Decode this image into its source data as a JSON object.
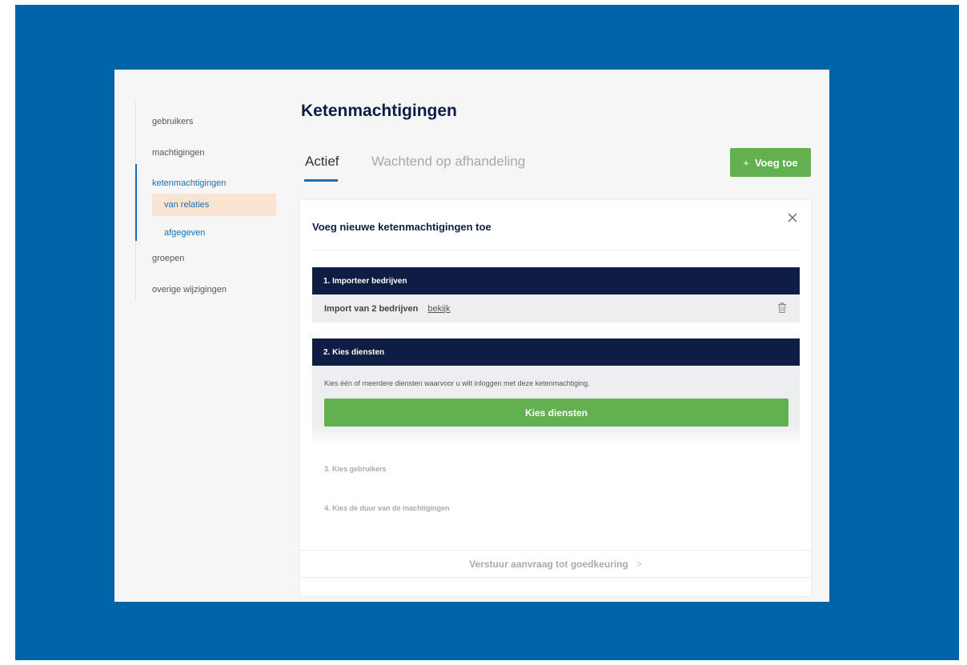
{
  "colors": {
    "background_frame": "#0064a8",
    "accent_blue": "#1a6db6",
    "navy": "#0f1d44",
    "green": "#62b04f",
    "highlight": "#fbe4d2"
  },
  "sidebar": {
    "items": [
      {
        "label": "gebruikers"
      },
      {
        "label": "machtigingen"
      },
      {
        "label": "ketenmachtigingen"
      },
      {
        "label": "groepen"
      },
      {
        "label": "overige wijzigingen"
      }
    ],
    "subitems": [
      {
        "label": "van relaties"
      },
      {
        "label": "afgegeven"
      }
    ]
  },
  "page": {
    "title": "Ketenmachtigingen",
    "tabs": [
      {
        "label": "Actief"
      },
      {
        "label": "Wachtend op afhandeling"
      }
    ],
    "add_button": {
      "icon": "plus-icon",
      "plus": "+",
      "label": "Voeg toe"
    }
  },
  "panel": {
    "title": "Voeg nieuwe ketenmachtigingen toe",
    "close_icon": "close-icon",
    "step1": {
      "header": "1. Importeer bedrijven",
      "import_text": "Import van 2 bedrijven",
      "view_link": "bekijk",
      "delete_icon": "trash-icon"
    },
    "step2": {
      "header": "2. Kies diensten",
      "description": "Kies één of meerdere diensten waarvoor u wilt inloggen met deze ketenmachtiging.",
      "button": "Kies diensten"
    },
    "step3": "3. Kies gebruikers",
    "step4": "4. Kies de duur van de machtigingen",
    "footer": {
      "label": "Verstuur aanvraag tot goedkeuring",
      "chevron": ">"
    }
  }
}
